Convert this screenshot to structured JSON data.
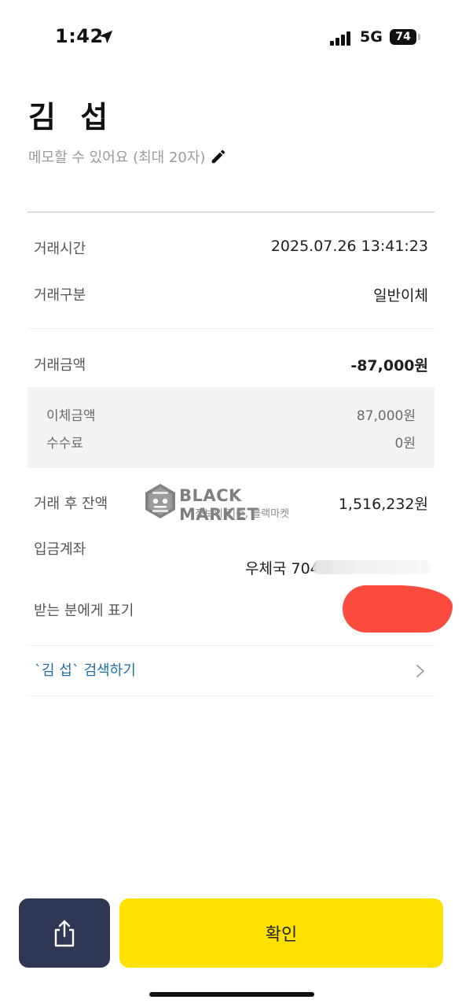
{
  "status_bar": {
    "time": "1:42",
    "network": "5G",
    "battery": "74",
    "icons": [
      "location-arrow-icon",
      "signal-icon",
      "battery-icon"
    ]
  },
  "header": {
    "recipient_name": "김 섭",
    "memo_placeholder": "메모할 수 있어요 (최대 20자)",
    "memo_icon": "pencil-icon"
  },
  "details": {
    "time_label": "거래시간",
    "time_value": "2025.07.26 13:41:23",
    "type_label": "거래구분",
    "type_value": "일반이체",
    "amount_label": "거래금액",
    "amount_value": "-87,000원",
    "transfer_label": "이체금액",
    "transfer_value": "87,000원",
    "fee_label": "수수료",
    "fee_value": "0원",
    "balance_label": "거래 후 잔액",
    "balance_value": "1,516,232원",
    "account_label": "입금계좌",
    "account_value": "우체국 704",
    "display_label": "받는 분에게 표기"
  },
  "watermark": {
    "brand": "BLACK MARKET",
    "slogan": "정보의 기준, 블랙마켓",
    "logo_text": "BLACK MARKET"
  },
  "search": {
    "label": "`김  섭` 검색하기",
    "icon": "chevron-right-icon"
  },
  "footer": {
    "share_icon": "share-icon",
    "confirm_label": "확인"
  },
  "colors": {
    "confirm": "#ffe100",
    "share": "#2f3754",
    "link": "#1d6fa5",
    "redaction": "#fb4a3e",
    "fee_bg": "#f2f3f5"
  }
}
